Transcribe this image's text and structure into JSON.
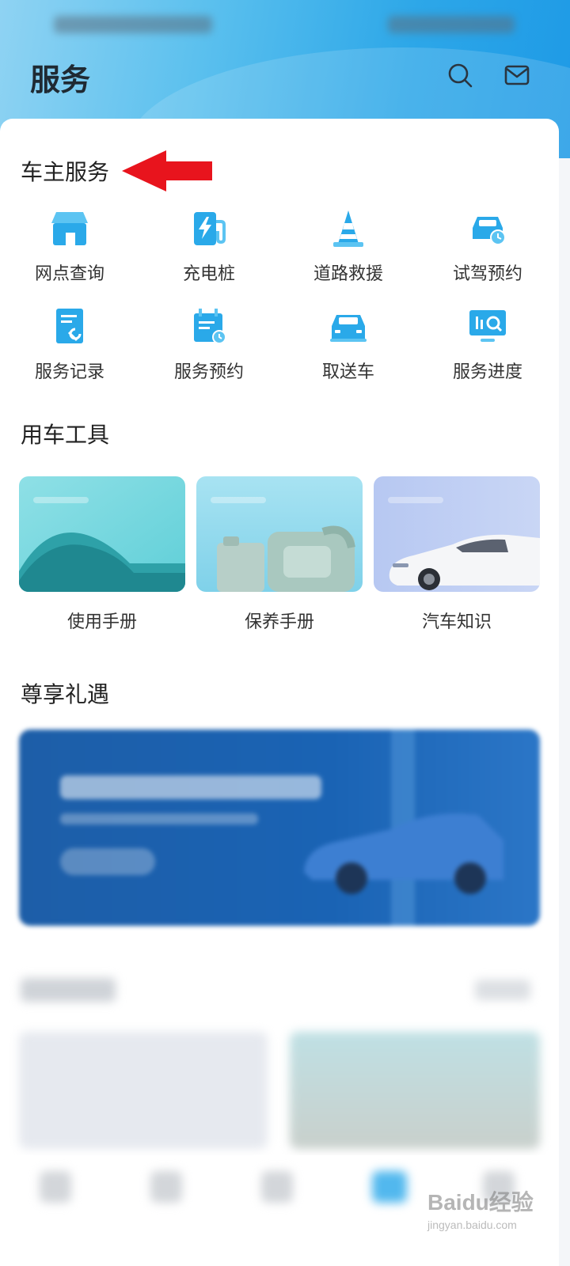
{
  "header": {
    "title": "服务",
    "search_icon": "search-icon",
    "mail_icon": "mail-icon",
    "bg_color": "#2da7e8"
  },
  "owner_services": {
    "title": "车主服务",
    "items": [
      {
        "label": "网点查询",
        "icon": "store-icon"
      },
      {
        "label": "充电桩",
        "icon": "charging-pile-icon"
      },
      {
        "label": "道路救援",
        "icon": "traffic-cone-icon"
      },
      {
        "label": "试驾预约",
        "icon": "test-drive-icon"
      },
      {
        "label": "服务记录",
        "icon": "service-record-icon"
      },
      {
        "label": "服务预约",
        "icon": "calendar-icon"
      },
      {
        "label": "取送车",
        "icon": "car-pickup-icon"
      },
      {
        "label": "服务进度",
        "icon": "progress-monitor-icon"
      }
    ]
  },
  "car_tools": {
    "title": "用车工具",
    "items": [
      {
        "label": "使用手册"
      },
      {
        "label": "保养手册"
      },
      {
        "label": "汽车知识"
      }
    ]
  },
  "privileges": {
    "title": "尊享礼遇"
  },
  "watermark": {
    "brand": "Baidu经验",
    "url": "jingyan.baidu.com"
  },
  "accent_color": "#28a9ea",
  "arrow_color": "#e8141d"
}
